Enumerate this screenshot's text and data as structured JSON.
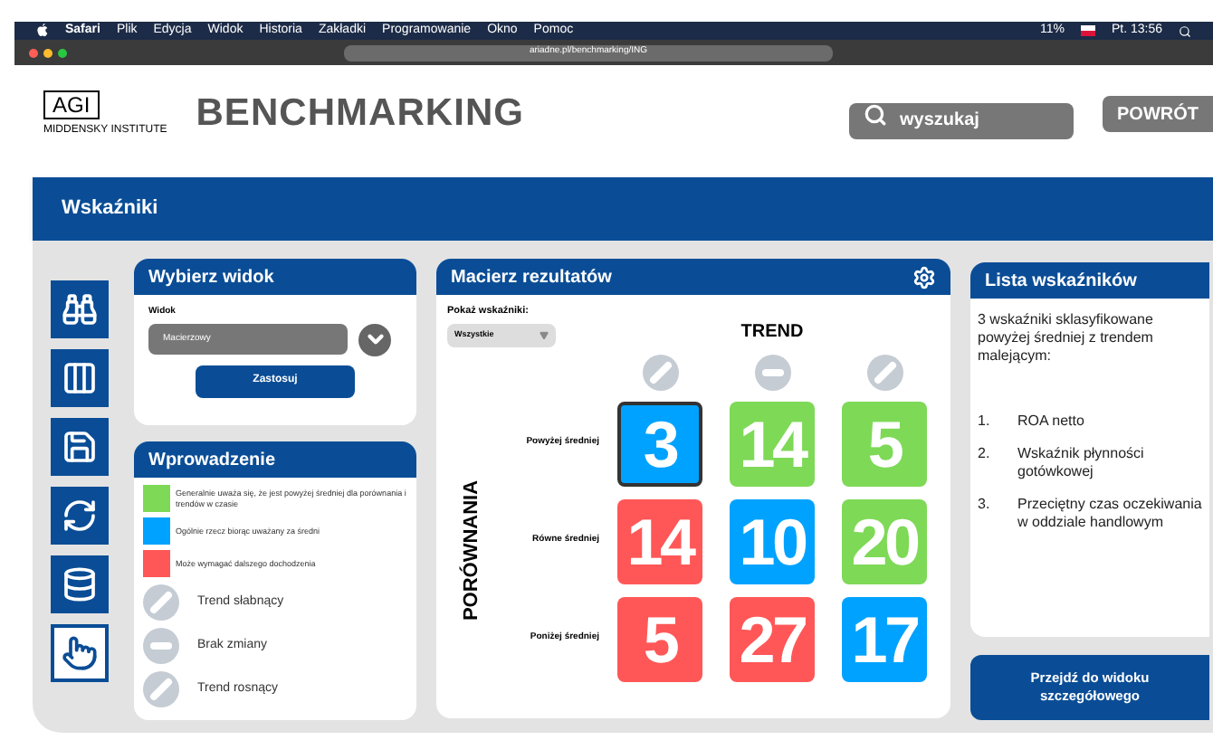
{
  "menu_bar": {
    "items": [
      "Safari",
      "Plik",
      "Edycja",
      "Widok",
      "Historia",
      "Zakładki",
      "Programowanie",
      "Okno",
      "Pomoc"
    ],
    "battery": "11%",
    "clock": "Pt. 13:56"
  },
  "browser": {
    "url": "ariadne.pl/benchmarking/ING"
  },
  "header": {
    "logo_text": "AGI",
    "logo_subtitle": "MIDDENSKY INSTITUTE",
    "title": "BENCHMARKING",
    "search": {
      "placeholder": "wyszukaj"
    },
    "back_button": "POWRÓT"
  },
  "section_title": "Wskaźniki",
  "sidebar": {
    "items": [
      {
        "kind": "binoculars",
        "selected": false
      },
      {
        "kind": "columns",
        "selected": false
      },
      {
        "kind": "save",
        "selected": false
      },
      {
        "kind": "cycle",
        "selected": false
      },
      {
        "kind": "database",
        "selected": false
      },
      {
        "kind": "pointer",
        "selected": true
      }
    ]
  },
  "view_card": {
    "title": "Wybierz widok",
    "field_label": "Widok",
    "value": "Macierzowy",
    "apply_button": "Zastosuj"
  },
  "intro_card": {
    "title": "Wprowadzenie",
    "legend": [
      {
        "color": "#7ed957",
        "text": "Generalnie uważa się, że jest powyżej średniej dla porównania i trendów w czasie"
      },
      {
        "color": "#00a2ff",
        "text": "Ogólnie rzecz biorąc uważany za średni"
      },
      {
        "color": "#ff5757",
        "text": "Może wymagać dalszego dochodzenia"
      }
    ],
    "trends": [
      {
        "kind": "down",
        "text": "Trend słabnący"
      },
      {
        "kind": "flat",
        "text": "Brak zmiany"
      },
      {
        "kind": "up",
        "text": "Trend rosnący"
      }
    ]
  },
  "matrix": {
    "title": "Macierz rezultatów",
    "filter_label": "Pokaż wskaźniki:",
    "filter_value": "Wszystkie",
    "column_axis": "TREND",
    "row_axis": "PORÓWNANIA",
    "columns": [
      {
        "kind": "down"
      },
      {
        "kind": "flat"
      },
      {
        "kind": "up"
      }
    ],
    "rows": [
      {
        "label": "Powyżej średniej",
        "cells": [
          {
            "value": "3",
            "color": "#00a2ff",
            "selected": true
          },
          {
            "value": "14",
            "color": "#7ed957",
            "selected": false
          },
          {
            "value": "5",
            "color": "#7ed957",
            "selected": false
          }
        ]
      },
      {
        "label": "Równe średniej",
        "cells": [
          {
            "value": "14",
            "color": "#ff5757",
            "selected": false
          },
          {
            "value": "10",
            "color": "#00a2ff",
            "selected": false
          },
          {
            "value": "20",
            "color": "#7ed957",
            "selected": false
          }
        ]
      },
      {
        "label": "Poniżej średniej",
        "cells": [
          {
            "value": "5",
            "color": "#ff5757",
            "selected": false
          },
          {
            "value": "27",
            "color": "#ff5757",
            "selected": false
          },
          {
            "value": "17",
            "color": "#00a2ff",
            "selected": false
          }
        ]
      }
    ]
  },
  "list_card": {
    "title": "Lista wskaźników",
    "intro": "3 wskaźniki sklasyfikowane powyżej średniej z trendem malejącym:",
    "items": [
      {
        "number": "1.",
        "text": "ROA netto"
      },
      {
        "number": "2.",
        "text": "Wskaźnik płynności gotówkowej"
      },
      {
        "number": "3.",
        "text": "Przeciętny czas oczekiwania w oddziale handlowym"
      }
    ]
  },
  "detail_button": "Przejdź do widoku szczegółowego"
}
